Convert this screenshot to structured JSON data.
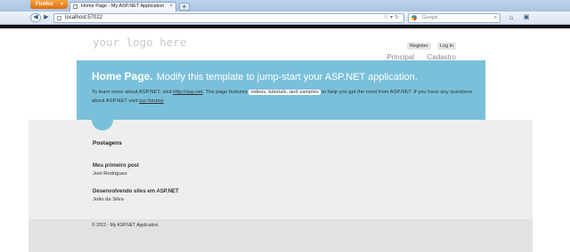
{
  "browser": {
    "app_button": "Firefox",
    "tab_title": "Home Page - My ASP.NET Application",
    "url": "localhost:57022",
    "search_placeholder": "Google"
  },
  "site": {
    "logo": "your logo here",
    "login_links": [
      "Register",
      "Log in"
    ],
    "menu": [
      "Principal",
      "Cadastro"
    ]
  },
  "featured": {
    "title_bold": "Home Page.",
    "title_rest": "Modify this template to jump-start your ASP.NET application.",
    "text_parts": {
      "p1": "To learn more about ASP.NET, visit",
      "link1": "http://asp.net",
      "p2": ". The page features",
      "link2": "videos, tutorials, and samples",
      "p3": "to help you get the most from ASP.NET. If you have any questions about ASP.NET visit",
      "link3": "our forums",
      "p4": "."
    }
  },
  "posts": {
    "section_title": "Postagens",
    "items": [
      {
        "title": "Meu primeiro post",
        "author": "Joel Rodrigues"
      },
      {
        "title": "Desenvolvendo sites em ASP.NET",
        "author": "João da Silva"
      }
    ]
  },
  "footer": {
    "copyright": "© 2012 - My ASP.NET Application"
  }
}
